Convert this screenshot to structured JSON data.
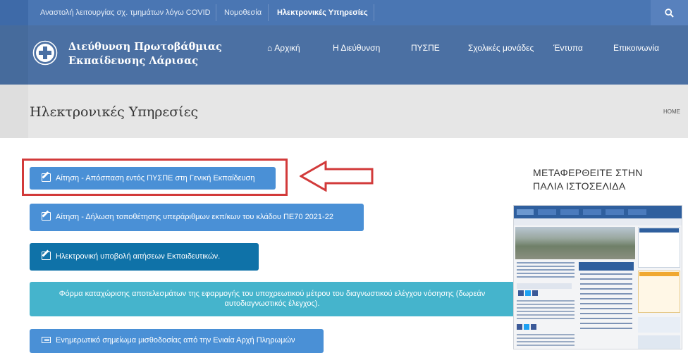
{
  "topbar": {
    "links": [
      {
        "label": "Αναστολή λειτουργίας σχ. τμημάτων λόγω COVID"
      },
      {
        "label": "Νομοθεσία"
      },
      {
        "label": "Ηλεκτρονικές Υπηρεσίες"
      }
    ],
    "search_icon": "search-icon"
  },
  "header": {
    "brand_line1": "Διεύθυνση Πρωτοβάθμιας",
    "brand_line2": "Εκπαίδευσης Λάρισας",
    "nav": [
      {
        "label": "Αρχική",
        "icon": "home-icon"
      },
      {
        "label": "Η Διεύθυνση"
      },
      {
        "label": "ΠΥΣΠΕ"
      },
      {
        "label": "Σχολικές μονάδες"
      },
      {
        "label": "Έντυπα"
      },
      {
        "label": "Επικοινωνία"
      }
    ]
  },
  "titlebar": {
    "title": "Ηλεκτρονικές Υπηρεσίες",
    "breadcrumb": "HOME"
  },
  "services": [
    {
      "label": "Αίτηση - Απόσπαση εντός ΠΥΣΠΕ στη Γενική Εκπαίδευση",
      "icon": "edit-icon"
    },
    {
      "label": "Αίτηση - Δήλωση τοποθέτησης υπεράριθμων εκπ/κων του κλάδου ΠΕ70 2021-22",
      "icon": "edit-icon"
    },
    {
      "label": "Ηλεκτρονική υποβολή αιτήσεων Εκπαιδευτικών.",
      "icon": "edit-icon"
    },
    {
      "label_line1": "Φόρμα καταχώρισης αποτελεσμάτων της εφαρμογής του υποχρεωτικού μέτρου του διαγνωστικού ελέγχου νόσησης (δωρεάν",
      "label_line2": "αυτοδιαγνωστικός έλεγχος)."
    },
    {
      "label": "Ενημερωτικό σημείωμα μισθοδοσίας από την Ενιαία Αρχή Πληρωμών",
      "icon": "list-icon"
    }
  ],
  "sidebar": {
    "heading_line1": "ΜΕΤΑΦΕΡΘΕΙΤΕ ΣΤΗΝ",
    "heading_line2": "ΠΑΛΙΑ ΙΣΤΟΣΕΛΙΔΑ"
  },
  "colors": {
    "topbar": "#4a76b3",
    "header": "#4b70a3",
    "button_blue": "#4a90d6",
    "button_dark": "#0f72a8",
    "button_teal": "#45b4cc",
    "highlight_red": "#d23a3a"
  }
}
